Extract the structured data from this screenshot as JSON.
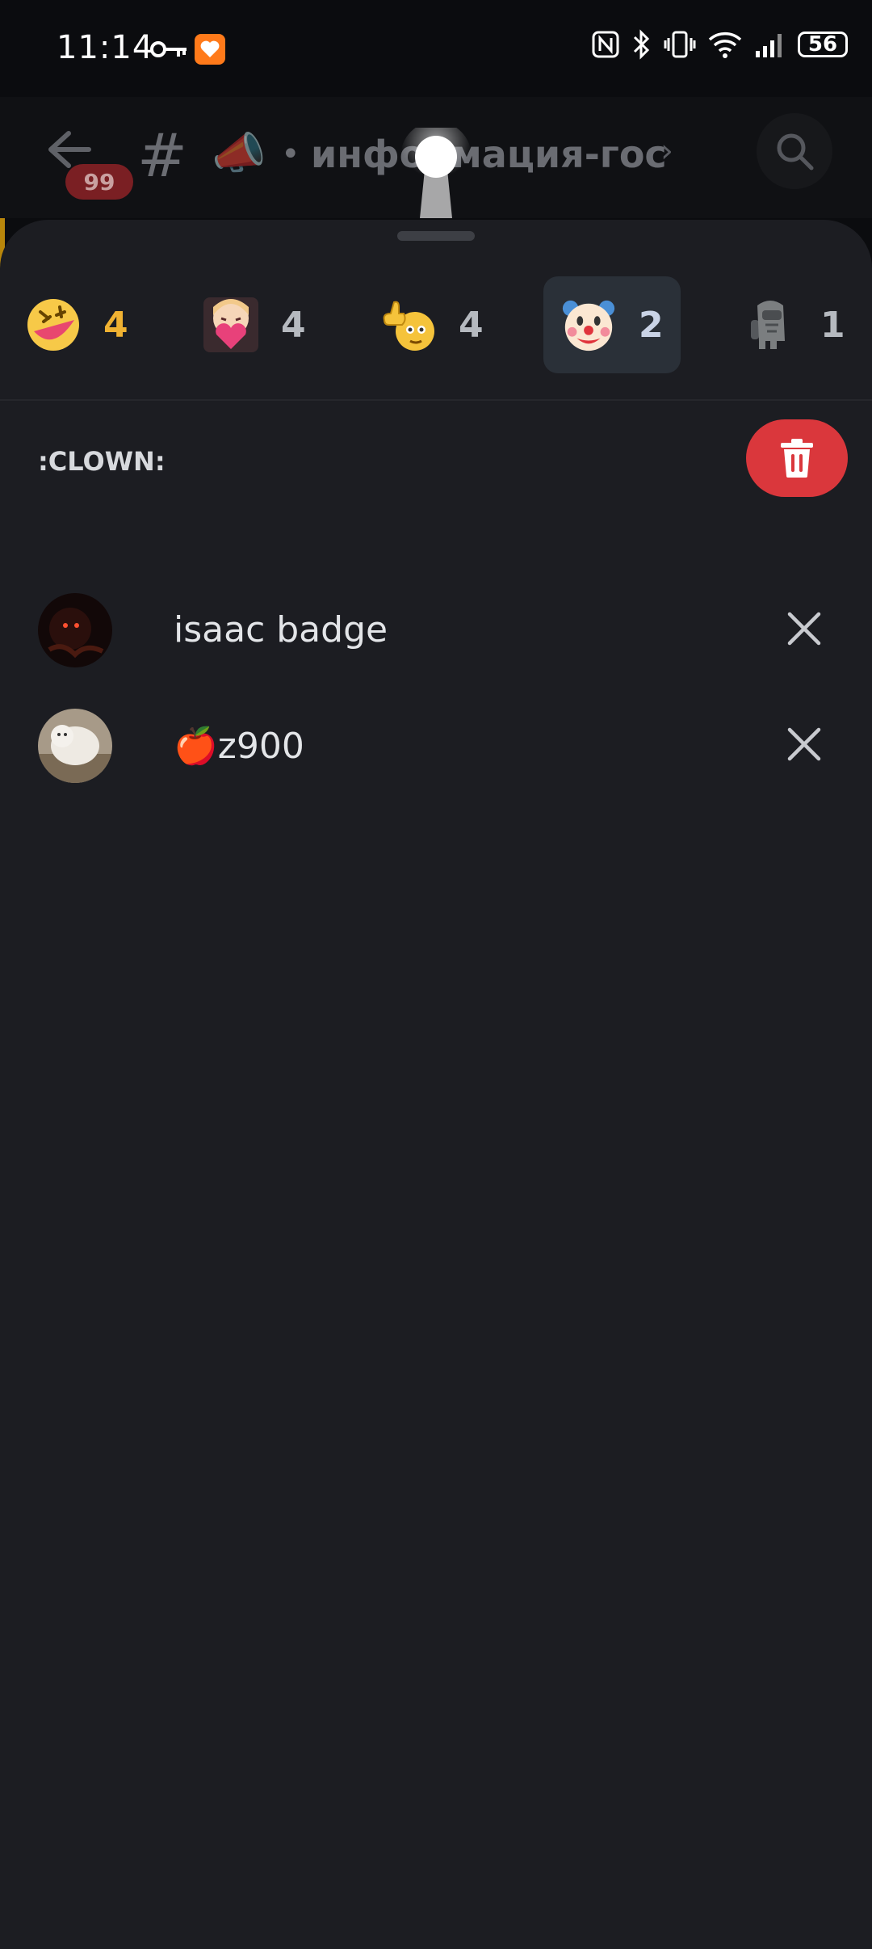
{
  "status_bar": {
    "time": "11:14",
    "battery": "56",
    "icons": [
      "key-icon",
      "app-badge-icon",
      "nfc-icon",
      "bluetooth-icon",
      "vibrate-icon",
      "wifi-icon",
      "signal-icon",
      "battery-icon"
    ]
  },
  "header": {
    "unread_count": "99",
    "channel_name": "информация-гос",
    "separator": "•"
  },
  "reactions": {
    "tabs": [
      {
        "icon": "rofl-emoji",
        "count": "4",
        "selected": false
      },
      {
        "icon": "anime-heart-emoji",
        "count": "4",
        "selected": false
      },
      {
        "icon": "thumbs-up-emoji",
        "count": "4",
        "selected": false
      },
      {
        "icon": "clown-emoji",
        "count": "2",
        "selected": true
      },
      {
        "icon": "moai-amogus-emoji",
        "count": "1",
        "selected": false
      }
    ],
    "selected_name": ":CLOWN:",
    "users": [
      {
        "name": "isaac badge",
        "avatar": "dark-avatar"
      },
      {
        "name": "🍎z900",
        "avatar": "dog-avatar"
      }
    ]
  },
  "colors": {
    "sheet_bg": "#1c1d22",
    "selected_tab": "#2a3038",
    "delete_red": "#da373c",
    "gold": "#f0b232"
  }
}
